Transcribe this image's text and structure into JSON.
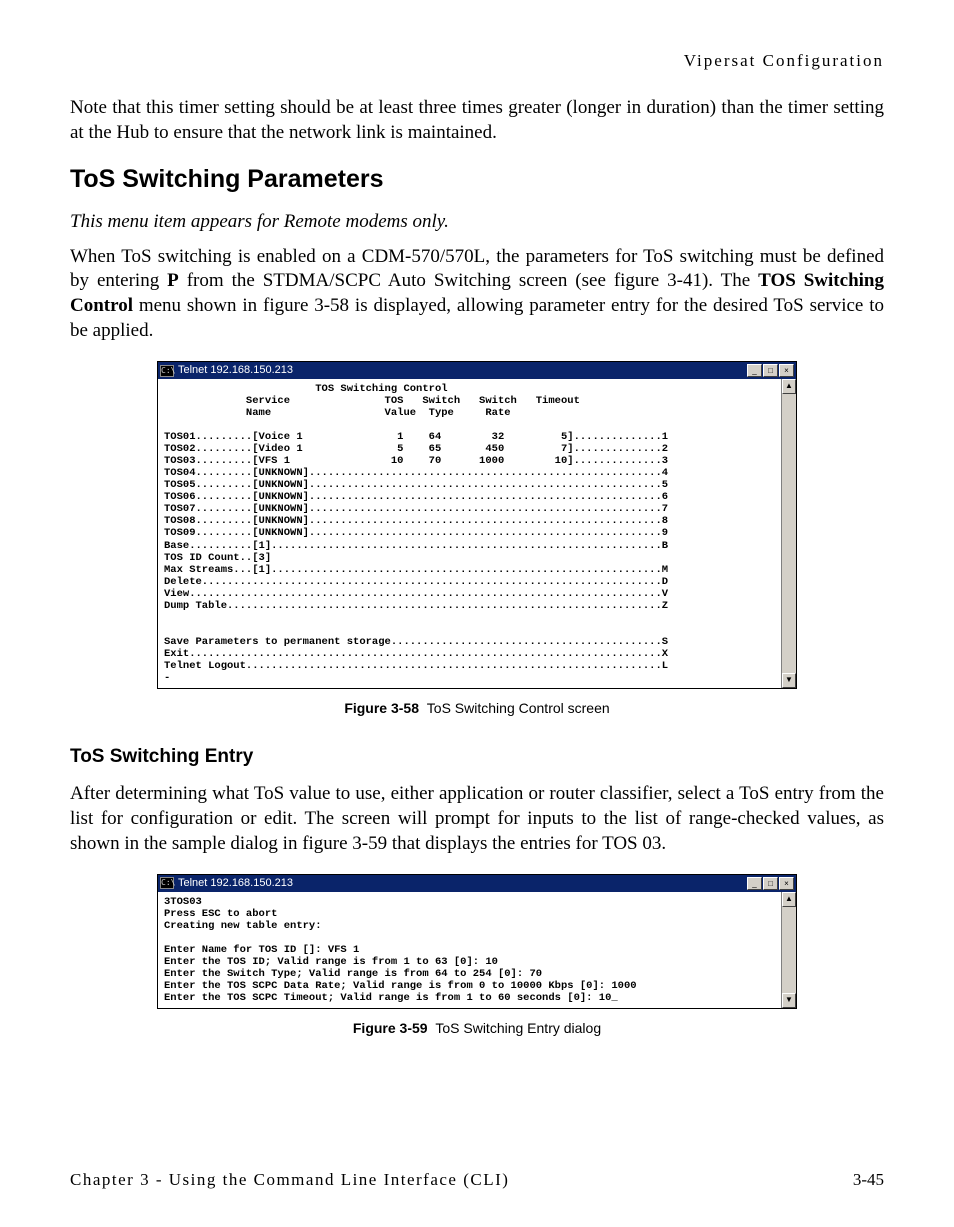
{
  "header": {
    "section_title": "Vipersat Configuration"
  },
  "intro_para": "Note that this timer setting should be at least three times greater (longer in duration) than the timer setting at the Hub to ensure that the network link is maintained.",
  "section": {
    "heading": "ToS Switching Parameters",
    "note": "This menu item appears for Remote modems only.",
    "para_parts": {
      "p1": "When ToS switching is enabled on a CDM-570/570L, the parameters for ToS switching must be defined by entering ",
      "p_bold1": "P",
      "p2": " from the STDMA/SCPC Auto Switching screen (see figure 3-41). The ",
      "p_bold2": "TOS Switching Control",
      "p3": " menu shown in figure 3-58 is displayed, allowing parameter entry for the desired ToS service to be applied."
    }
  },
  "fig58": {
    "title": "Telnet 192.168.150.213",
    "caption_bold": "Figure 3-58",
    "caption_rest": "ToS Switching Control screen",
    "content": "                        TOS Switching Control\n             Service               TOS   Switch   Switch   Timeout\n             Name                  Value  Type     Rate\n\nTOS01.........[Voice 1               1    64        32         5]..............1\nTOS02.........[Video 1               5    65       450         7]..............2\nTOS03.........[VFS 1                10    70      1000        10]..............3\nTOS04.........[UNKNOWN]........................................................4\nTOS05.........[UNKNOWN]........................................................5\nTOS06.........[UNKNOWN]........................................................6\nTOS07.........[UNKNOWN]........................................................7\nTOS08.........[UNKNOWN]........................................................8\nTOS09.........[UNKNOWN]........................................................9\nBase..........[1]..............................................................B\nTOS ID Count..[3]\nMax Streams...[1]..............................................................M\nDelete.........................................................................D\nView...........................................................................V\nDump Table.....................................................................Z\n\n\nSave Parameters to permanent storage...........................................S\nExit...........................................................................X\nTelnet Logout..................................................................L\n-"
  },
  "subsection": {
    "heading": "ToS Switching Entry",
    "para": "After determining what ToS value to use, either application or router classifier, select a ToS entry from the list for configuration or edit. The screen will prompt for inputs to the list of range-checked values, as shown in the sample dialog in figure 3-59 that displays the entries for TOS 03."
  },
  "fig59": {
    "title": "Telnet 192.168.150.213",
    "caption_bold": "Figure 3-59",
    "caption_rest": "ToS Switching Entry dialog",
    "content": "3TOS03\nPress ESC to abort\nCreating new table entry:\n\nEnter Name for TOS ID []: VFS 1\nEnter the TOS ID; Valid range is from 1 to 63 [0]: 10\nEnter the Switch Type; Valid range is from 64 to 254 [0]: 70\nEnter the TOS SCPC Data Rate; Valid range is from 0 to 10000 Kbps [0]: 1000\nEnter the TOS SCPC Timeout; Valid range is from 1 to 60 seconds [0]: 10_"
  },
  "footer": {
    "chapter": "Chapter 3 - Using the Command Line Interface (CLI)",
    "page": "3-45"
  },
  "window_controls": {
    "minimize": "_",
    "maximize": "□",
    "close": "×",
    "up": "▲",
    "down": "▼",
    "icon": "C:\\"
  }
}
